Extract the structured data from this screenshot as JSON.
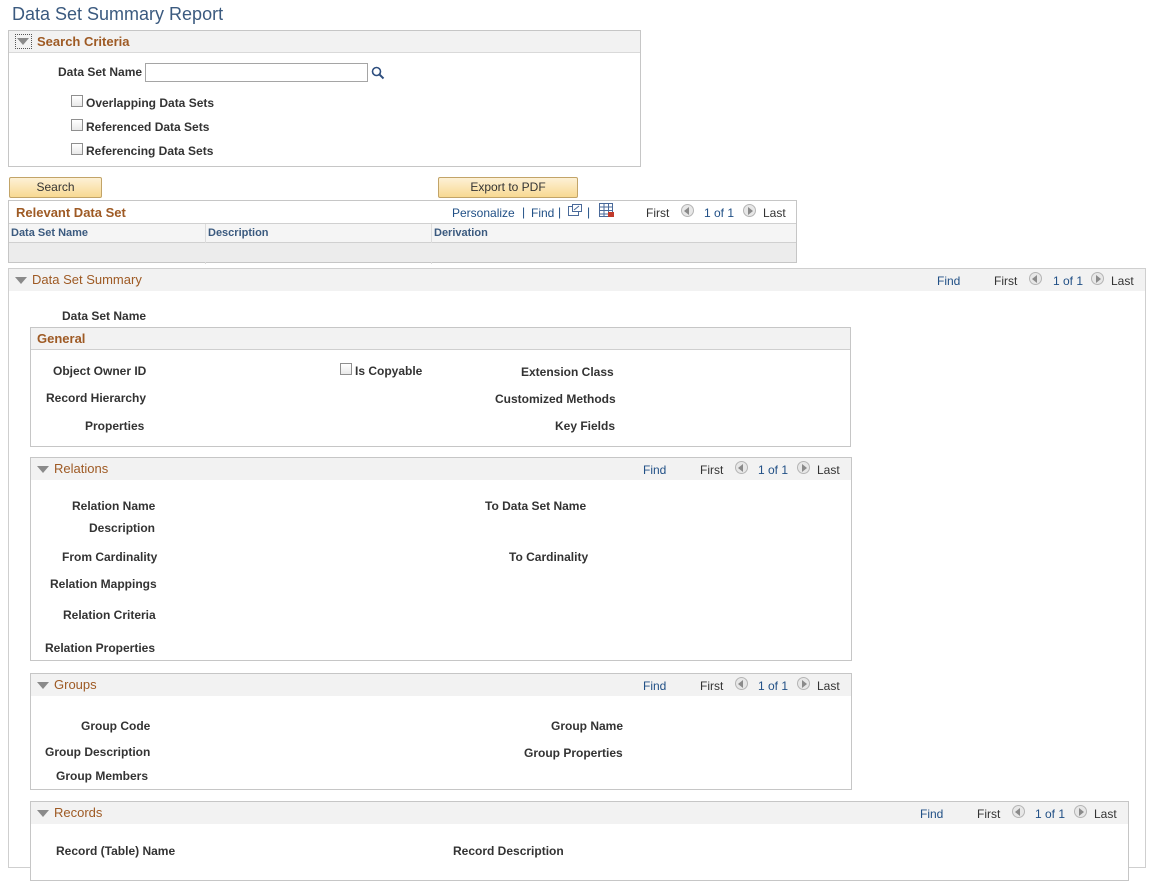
{
  "page_title": "Data Set Summary Report",
  "search_criteria": {
    "title": "Search Criteria",
    "data_set_name_label": "Data Set Name",
    "data_set_name_value": "",
    "checkboxes": [
      "Overlapping Data Sets",
      "Referenced Data Sets",
      "Referencing Data Sets"
    ]
  },
  "buttons": {
    "search": "Search",
    "export_pdf": "Export to PDF"
  },
  "relevant_grid": {
    "title": "Relevant Data Set",
    "personalize": "Personalize",
    "find": "Find",
    "columns": [
      "Data Set Name",
      "Description",
      "Derivation"
    ],
    "nav": {
      "first": "First",
      "count": "1 of 1",
      "last": "Last"
    }
  },
  "summary": {
    "title": "Data Set Summary",
    "find": "Find",
    "nav": {
      "first": "First",
      "count": "1 of 1",
      "last": "Last"
    },
    "data_set_name_label": "Data Set Name",
    "general": {
      "title": "General",
      "object_owner_id": "Object Owner ID",
      "is_copyable": "Is Copyable",
      "extension_class": "Extension Class",
      "record_hierarchy": "Record Hierarchy",
      "customized_methods": "Customized Methods",
      "properties": "Properties",
      "key_fields": "Key Fields"
    },
    "relations": {
      "title": "Relations",
      "find": "Find",
      "nav": {
        "first": "First",
        "count": "1 of 1",
        "last": "Last"
      },
      "relation_name": "Relation Name",
      "to_data_set_name": "To Data Set Name",
      "description": "Description",
      "from_cardinality": "From Cardinality",
      "to_cardinality": "To Cardinality",
      "relation_mappings": "Relation Mappings",
      "relation_criteria": "Relation Criteria",
      "relation_properties": "Relation Properties"
    },
    "groups": {
      "title": "Groups",
      "find": "Find",
      "nav": {
        "first": "First",
        "count": "1 of 1",
        "last": "Last"
      },
      "group_code": "Group Code",
      "group_name": "Group Name",
      "group_description": "Group Description",
      "group_properties": "Group Properties",
      "group_members": "Group Members"
    },
    "records": {
      "title": "Records",
      "find": "Find",
      "nav": {
        "first": "First",
        "count": "1 of 1",
        "last": "Last"
      },
      "record_table_name": "Record (Table) Name",
      "record_description": "Record Description"
    }
  },
  "colors": {
    "title": "#3b5a7f",
    "section": "#9e5a24",
    "link": "#215086",
    "button": "#f8d992"
  }
}
